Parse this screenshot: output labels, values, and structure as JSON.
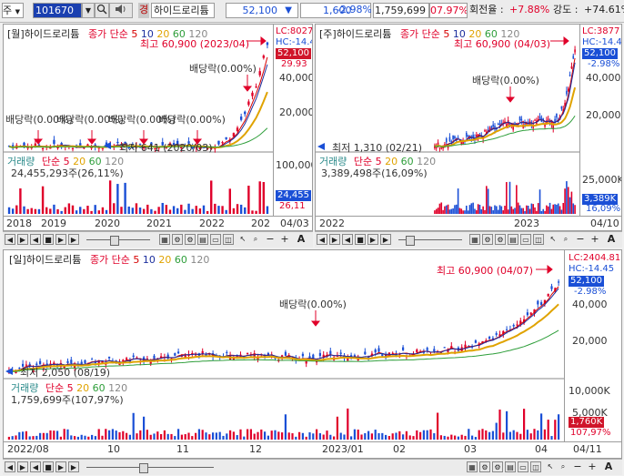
{
  "toolbar": {
    "market": "주",
    "code": "101670",
    "name": "하이드로리튬",
    "price": "52,100",
    "change_arrow": "▼",
    "change": "1,600",
    "change_rate": "-2.98%",
    "volume": "1,759,699",
    "volume_ratio": "07.97%",
    "turnover_label": "회전율 :",
    "turnover": "+7.88%",
    "strength_label": "강도 :",
    "strength": "+74.61%",
    "dropdown_glyph": "▼",
    "gyeong": "경"
  },
  "monthly": {
    "title": "[월]하이드로리튬",
    "ma_label": "종가 단순",
    "ma_periods": [
      "5",
      "10",
      "20",
      "60",
      "120"
    ],
    "high_note": "최고 60,900 (2023/04)",
    "low_note": "최저 641 (2020/03)",
    "dividend": "배당락(0.00%)",
    "y_labels": [
      "40,000",
      "20,000"
    ],
    "lc": "LC:8027",
    "hc": "HC:-14.4",
    "price_tag": "52,100",
    "pct_tag": "29.93",
    "vol_title": "거래량",
    "vol_ma_label": "단순",
    "vol_periods": [
      "5",
      "20",
      "60",
      "120"
    ],
    "vol_value": "24,455,293주(26,11%)",
    "vol_y": "100,000",
    "vol_tag1": "24,455",
    "vol_tag2": "26,11",
    "x_labels": [
      "2018",
      "2019",
      "2020",
      "2021",
      "2022",
      "202"
    ],
    "date": "04/03"
  },
  "weekly": {
    "title": "[주]하이드로리튬",
    "ma_label": "종가 단순",
    "ma_periods": [
      "5",
      "10",
      "20",
      "60",
      "120"
    ],
    "high_note": "최고 60,900 (04/03)",
    "low_note": "최저 1,310 (02/21)",
    "dividend": "배당락(0.00%)",
    "y_labels": [
      "40,000",
      "20,000"
    ],
    "lc": "LC:3877",
    "hc": "HC:-14.4",
    "price_tag": "52,100",
    "pct_tag": "-2.98%",
    "vol_title": "거래량",
    "vol_ma_label": "단순",
    "vol_periods": [
      "5",
      "20",
      "60",
      "120"
    ],
    "vol_value": "3,389,498주(16,09%)",
    "vol_y": "25,000K",
    "vol_tag1": "3,389K",
    "vol_tag2": "16,09%",
    "x_labels": [
      "2022",
      "2023"
    ],
    "date": "04/10"
  },
  "daily": {
    "title": "[일]하이드로리튬",
    "ma_label": "종가 단순",
    "ma_periods": [
      "5",
      "10",
      "20",
      "60",
      "120"
    ],
    "high_note": "최고 60,900 (04/07)",
    "low_note": "최저 2,050 (08/19)",
    "dividend": "배당락(0.00%)",
    "y_labels": [
      "40,000",
      "20,000"
    ],
    "lc": "LC:2404.81",
    "hc": "HC:-14.45",
    "price_tag": "52,100",
    "pct_tag": "-2.98%",
    "vol_title": "거래량",
    "vol_ma_label": "단순",
    "vol_periods": [
      "5",
      "20",
      "60",
      "120"
    ],
    "vol_value": "1,759,699주(107,97%)",
    "vol_y": "10,000K",
    "vol_y2": "5,000K",
    "vol_tag1": "1,760K",
    "vol_tag2": "107,97%",
    "x_labels": [
      "2022/08",
      "10",
      "11",
      "12",
      "2023/01",
      "02",
      "03",
      "04"
    ],
    "date": "04/11"
  },
  "nav": {
    "letter": "A",
    "plus": "+",
    "minus": "−"
  },
  "colors": {
    "up": "#e0002a",
    "down": "#1a4fd6",
    "ma5": "#d60000",
    "ma10": "#1c2f9e",
    "ma20": "#e0a300",
    "ma60": "#2e9e3a",
    "ma120": "#888888",
    "axis_bg": "#eef2fb"
  }
}
